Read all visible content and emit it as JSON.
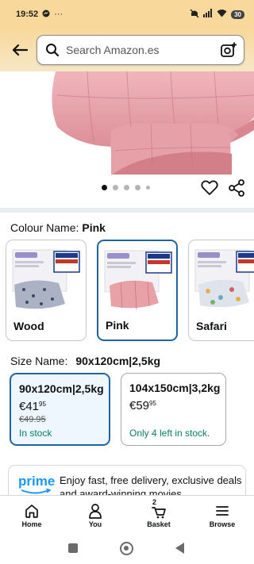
{
  "status_bar": {
    "time": "19:52",
    "extra": "···",
    "battery": "30"
  },
  "header": {
    "search_placeholder": "Search Amazon.es",
    "back_icon": "arrow-left-icon",
    "camera_icon": "camera-plus-icon"
  },
  "gallery": {
    "image_count": 5,
    "active_index": 0
  },
  "colour": {
    "label": "Colour Name:",
    "selected": "Pink",
    "options": [
      {
        "name": "Wood",
        "color": "#aab2c4"
      },
      {
        "name": "Pink",
        "color": "#e9a1a8"
      },
      {
        "name": "Safari",
        "color": "#dfe4ec"
      }
    ]
  },
  "size": {
    "label": "Size Name:",
    "selected": "90x120cm|2,5kg",
    "options": [
      {
        "name": "90x120cm|2,5kg",
        "price_main": "€41",
        "price_cents": "95",
        "was": "€49.95",
        "stock": "In stock"
      },
      {
        "name": "104x150cm|3,2kg",
        "price_main": "€59",
        "price_cents": "95",
        "was": "",
        "stock": "Only 4 left in stock."
      }
    ]
  },
  "prime": {
    "logo": "prime",
    "text": "Enjoy fast, free delivery, exclusive deals and award-winning movies"
  },
  "bottom_nav": {
    "items": [
      {
        "label": "Home",
        "icon": "home-icon"
      },
      {
        "label": "You",
        "icon": "person-icon"
      },
      {
        "label": "Basket",
        "icon": "basket-icon",
        "count": "2"
      },
      {
        "label": "Browse",
        "icon": "menu-icon"
      }
    ]
  },
  "colors": {
    "header_bg": "#f9d89b",
    "selected_border": "#2162a1",
    "in_stock": "#067d62",
    "prime_blue": "#1a98ff"
  }
}
